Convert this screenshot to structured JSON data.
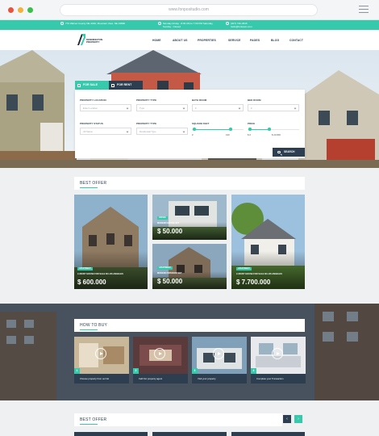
{
  "browser": {
    "url": "www.fonpositudio.com"
  },
  "topbar": {
    "address": "770 Walnut County NE 4326, Mountain View, NE 43890",
    "hours": "Monday-Friday : 8:00 AM to 7:00 PM Saturday, Sunday : Closed",
    "contact": "(007) 746-3546 hello@fonteam.com"
  },
  "nav": {
    "logo_text_1": "KENNINGTON",
    "logo_text_2": "PROPERTY",
    "items": [
      "HOME",
      "ABOUT US",
      "PROPERTIES",
      "SERVICE",
      "PAGES",
      "BLOG",
      "CONTACT"
    ]
  },
  "search": {
    "tab_sale": "FOR SALE",
    "tab_rent": "FOR RENT",
    "property_location_label": "PROPERTY LOCATION",
    "property_location_value": "Enter Location",
    "property_type_label": "PROPERTY TYPE",
    "property_type_value": "Type",
    "bath_room_label": "BATH ROOM",
    "bath_room_value": "#",
    "bed_room_label": "BED ROOM",
    "bed_room_value": "#",
    "property_status_label": "PROPERTY STATUS",
    "property_status_value": "All Status",
    "property_type2_label": "PROPERTY TYPE",
    "property_type2_value": "Residential Type",
    "square_feet_label": "SQUARE FEET",
    "square_min": "#",
    "square_max": "190",
    "price_label": "PRICE",
    "price_min": "$ #",
    "price_max": "$ 20.800",
    "square_range": [
      0.05,
      0.75
    ],
    "price_range": [
      0.05,
      0.42
    ],
    "button": "SEARCH"
  },
  "best_offer": {
    "title": "BEST OFFER",
    "cards": [
      {
        "badge": "APARTMENT",
        "title": "LUXURY HOUSE FOR SALE IN LOS ANGELES",
        "price": "$ 600.000"
      },
      {
        "badge": "OFFICE",
        "title": "MODERN HOUSE SET",
        "price": "$ 50.000"
      },
      {
        "badge": "APARTMENT",
        "title": "MODERN INTERIOR SET",
        "price": "$ 50.000"
      },
      {
        "badge": "APARTMENT",
        "title": "LUXURY HOUSE FOR SALE IN LOS ANGELES",
        "price": "$ 7.700.000"
      }
    ]
  },
  "how_to_buy": {
    "title": "HOW TO BUY",
    "steps": [
      {
        "num": "1",
        "caption": "Choose property from our list"
      },
      {
        "num": "2",
        "caption": "Call Our property agent"
      },
      {
        "num": "3",
        "caption": "Visit your property"
      },
      {
        "num": "4",
        "caption": "Complete your Transaction"
      }
    ]
  },
  "best_offer_2": {
    "title": "BEST OFFER",
    "prev": "‹",
    "next": "›"
  },
  "colors": {
    "accent": "#36c9ac",
    "dark": "#2c3e50"
  }
}
